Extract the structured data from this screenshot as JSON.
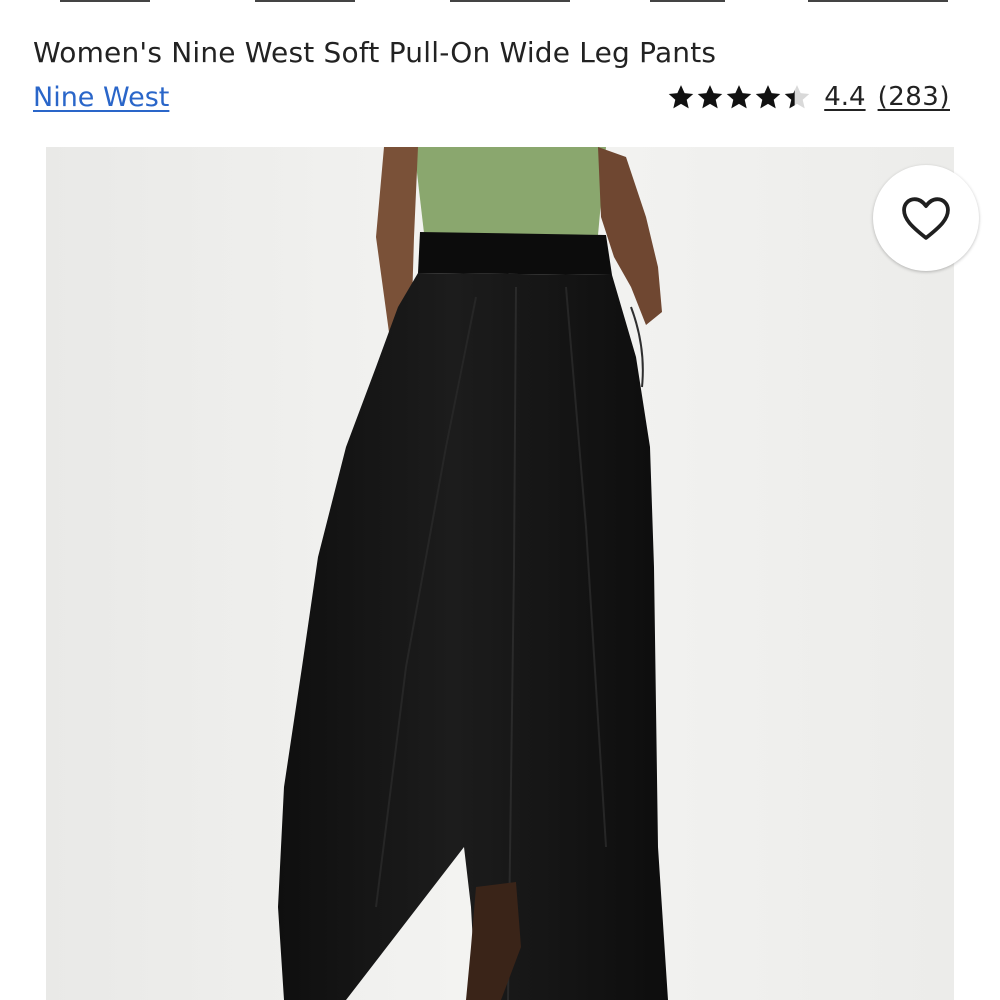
{
  "product": {
    "title": "Women's Nine West Soft Pull-On Wide Leg Pants",
    "brand": "Nine West"
  },
  "rating": {
    "value": "4.4",
    "count_text": "(283)",
    "stars_total": 5,
    "stars_filled": 4.4
  },
  "image": {
    "subject": "model wearing black wide leg pants with green top"
  },
  "icons": {
    "star": "star-icon",
    "favorite": "heart-outline-icon"
  },
  "colors": {
    "brand_link": "#2a66c9",
    "pants": "#151515",
    "top": "#8aa76e"
  }
}
